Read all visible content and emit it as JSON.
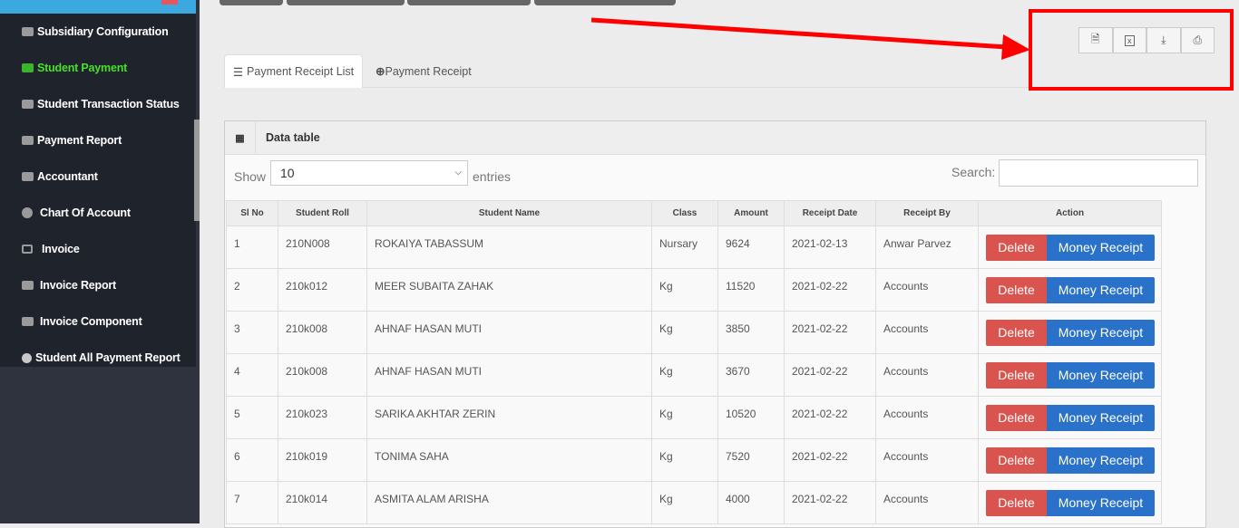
{
  "sidebar": {
    "items": [
      {
        "label": "Subsidiary Configuration",
        "icon": "briefcase-icon"
      },
      {
        "label": "Student Payment",
        "icon": "briefcase-icon",
        "active": true
      },
      {
        "label": "Student Transaction Status",
        "icon": "briefcase-icon"
      },
      {
        "label": "Payment Report",
        "icon": "briefcase-icon"
      },
      {
        "label": "Accountant",
        "icon": "briefcase-icon"
      },
      {
        "label": "Chart Of Account",
        "icon": "pie-chart-icon"
      },
      {
        "label": "Invoice",
        "icon": "window-icon"
      },
      {
        "label": "Invoice Report",
        "icon": "money-icon"
      },
      {
        "label": "Invoice Component",
        "icon": "money-icon"
      },
      {
        "label": "Student All Payment Report",
        "icon": "circle-icon"
      }
    ]
  },
  "tabs": [
    {
      "label": "Payment Receipt List",
      "icon": "list-icon"
    },
    {
      "label": "Payment Receipt",
      "icon": "plus-circle-icon"
    }
  ],
  "exports": [
    "pdf-icon",
    "excel-icon",
    "download-icon",
    "print-icon"
  ],
  "annotation": {
    "color": "#ff0000"
  },
  "panel": {
    "title": "Data table",
    "show": "Show",
    "length": "10",
    "entries": "entries",
    "search": "Search:"
  },
  "table": {
    "headers": [
      "Sl No",
      "Student Roll",
      "Student Name",
      "Class",
      "Amount",
      "Receipt Date",
      "Receipt By",
      "Action"
    ],
    "rows": [
      [
        "1",
        "210N008",
        "ROKAIYA TABASSUM",
        "Nursary",
        "9624",
        "2021-02-13",
        "Anwar Parvez"
      ],
      [
        "2",
        "210k012",
        "MEER SUBAITA ZAHAK",
        "Kg",
        "11520",
        "2021-02-22",
        "Accounts"
      ],
      [
        "3",
        "210k008",
        "AHNAF HASAN MUTI",
        "Kg",
        "3850",
        "2021-02-22",
        "Accounts"
      ],
      [
        "4",
        "210k008",
        "AHNAF HASAN MUTI",
        "Kg",
        "3670",
        "2021-02-22",
        "Accounts"
      ],
      [
        "5",
        "210k023",
        "SARIKA AKHTAR ZERIN",
        "Kg",
        "10520",
        "2021-02-22",
        "Accounts"
      ],
      [
        "6",
        "210k019",
        "TONIMA SAHA",
        "Kg",
        "7520",
        "2021-02-22",
        "Accounts"
      ],
      [
        "7",
        "210k014",
        "ASMITA ALAM ARISHA",
        "Kg",
        "4000",
        "2021-02-22",
        "Accounts"
      ]
    ],
    "delete_label": "Delete",
    "receipt_label": "Money Receipt"
  },
  "colors": {
    "delete": "#d9534f",
    "receipt": "#2a72c9",
    "active_menu": "#47e02b",
    "header_bar": "#3ba8e0"
  }
}
